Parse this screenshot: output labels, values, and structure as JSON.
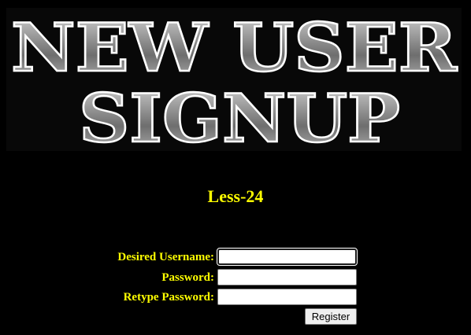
{
  "banner": {
    "line1": "NEW USER",
    "line2": "SIGNUP"
  },
  "heading": "Less-24",
  "form": {
    "username_label": "Desired Username:",
    "username_value": "",
    "password_label": "Password:",
    "password_value": "",
    "retype_label": "Retype Password:",
    "retype_value": "",
    "register_label": "Register"
  },
  "colors": {
    "background": "#000000",
    "label_text": "#ffff00",
    "banner_fill": "#8c8c8c"
  }
}
